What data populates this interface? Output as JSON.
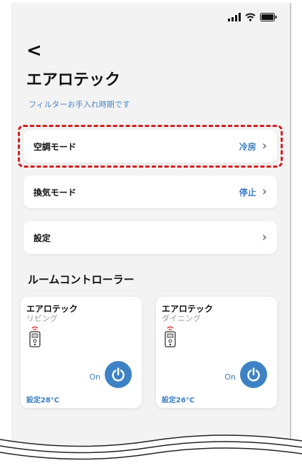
{
  "header": {
    "back_glyph": "<",
    "title": "エアロテック",
    "notice": "フィルターお手入れ時期です"
  },
  "settings": [
    {
      "label": "空調モード",
      "value": "冷房"
    },
    {
      "label": "換気モード",
      "value": "停止"
    },
    {
      "label": "設定",
      "value": ""
    }
  ],
  "room_controller": {
    "heading": "ルームコントローラー",
    "cards": [
      {
        "name": "エアロテック",
        "room": "リビング",
        "status": "On",
        "setting": "設定28°C"
      },
      {
        "name": "エアロテック",
        "room": "ダイニング",
        "status": "On",
        "setting": "設定26°C"
      }
    ]
  },
  "colors": {
    "accent": "#3d82c4",
    "highlight_border": "#d61f1f",
    "background": "#f3f3f3"
  }
}
